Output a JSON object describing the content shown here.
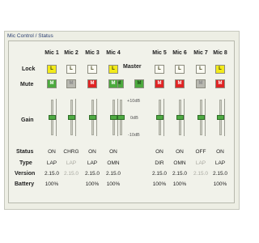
{
  "window": {
    "tab_title": "Mic Control / Status"
  },
  "row_labels": {
    "lock": "Lock",
    "mute": "Mute",
    "gain": "Gain",
    "status": "Status",
    "type": "Type",
    "version": "Version",
    "battery": "Battery"
  },
  "master": {
    "label": "Master",
    "lock_text": "L",
    "mute_text": "M",
    "gain_level_pct": 50
  },
  "gain_scale": {
    "top": "+10dB",
    "mid": "0dB",
    "bottom": "-10dB"
  },
  "colors": {
    "lock_on": "#f2ea1a",
    "lock_off": "#fafaf2",
    "mute_on": "#e02424",
    "mute_off": "#4caa3e",
    "mute_na": "#b8b8b0",
    "slider_knob": "#4eaa42"
  },
  "channels": [
    {
      "name": "Mic 1",
      "lock_text": "L",
      "lock_state": "on",
      "mute_text": "M",
      "mute_state": "off",
      "gain_level_pct": 50,
      "status": "ON",
      "type": "LAP",
      "version": "2.15.0",
      "battery": "100%"
    },
    {
      "name": "Mic 2",
      "lock_text": "L",
      "lock_state": "off",
      "mute_text": "M",
      "mute_state": "na",
      "gain_level_pct": 50,
      "status": "CHRG",
      "type": "LAP",
      "version": "2.15.0",
      "battery": "",
      "dim": true
    },
    {
      "name": "Mic 3",
      "lock_text": "L",
      "lock_state": "off",
      "mute_text": "M",
      "mute_state": "on",
      "gain_level_pct": 50,
      "status": "ON",
      "type": "LAP",
      "version": "2.15.0",
      "battery": "100%"
    },
    {
      "name": "Mic 4",
      "lock_text": "L",
      "lock_state": "on",
      "mute_text": "M",
      "mute_state": "off",
      "gain_level_pct": 50,
      "status": "ON",
      "type": "OMN",
      "version": "2.15.0",
      "battery": "100%"
    },
    {
      "name": "Mic 5",
      "lock_text": "L",
      "lock_state": "off",
      "mute_text": "M",
      "mute_state": "on",
      "gain_level_pct": 50,
      "status": "ON",
      "type": "DIR",
      "version": "2.15.0",
      "battery": "100%"
    },
    {
      "name": "Mic 6",
      "lock_text": "L",
      "lock_state": "off",
      "mute_text": "M",
      "mute_state": "on",
      "gain_level_pct": 50,
      "status": "ON",
      "type": "OMN",
      "version": "2.15.0",
      "battery": "100%"
    },
    {
      "name": "Mic 7",
      "lock_text": "L",
      "lock_state": "off",
      "mute_text": "M",
      "mute_state": "na",
      "gain_level_pct": 50,
      "status": "OFF",
      "type": "LAP",
      "version": "2.15.0",
      "battery": "",
      "dim": true
    },
    {
      "name": "Mic 8",
      "lock_text": "L",
      "lock_state": "on",
      "mute_text": "M",
      "mute_state": "on",
      "gain_level_pct": 50,
      "status": "ON",
      "type": "LAP",
      "version": "2.15.0",
      "battery": "100%"
    }
  ]
}
